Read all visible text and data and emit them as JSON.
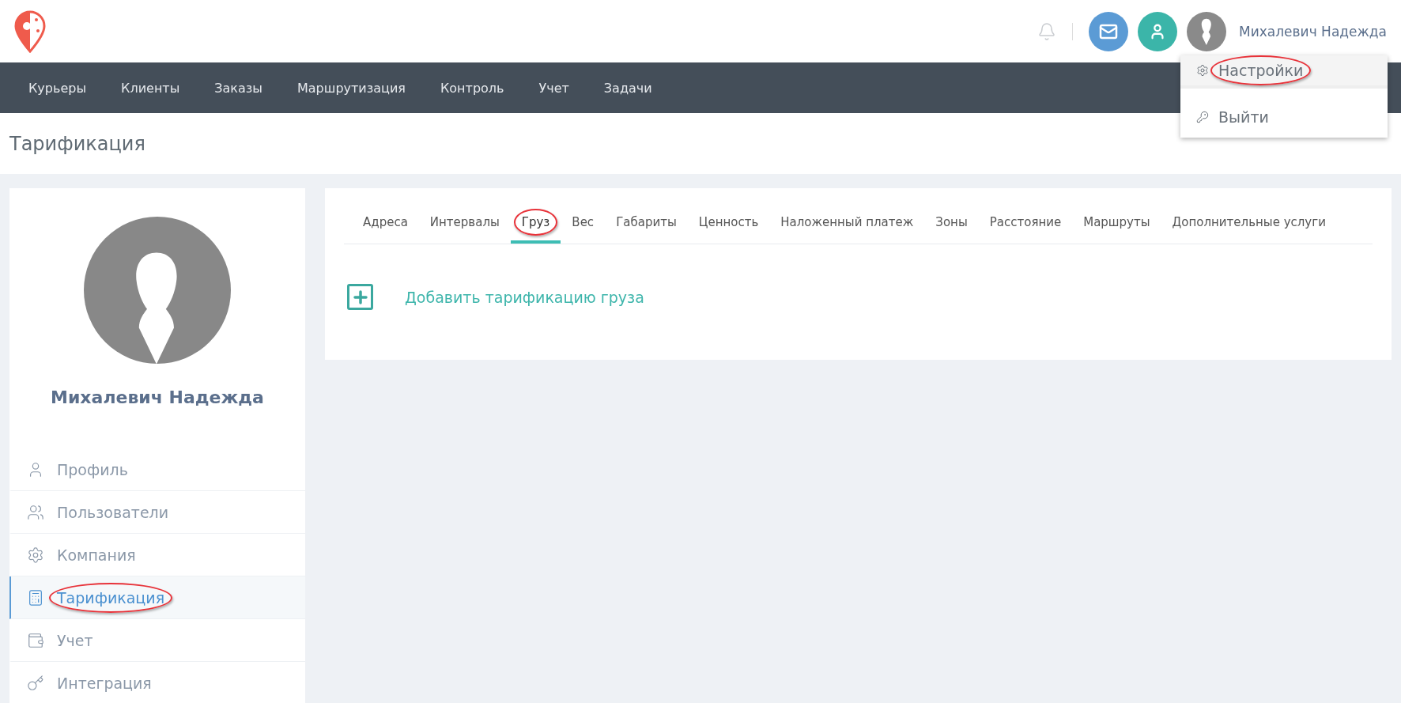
{
  "header": {
    "user_name": "Михалевич Надежда",
    "menu": [
      {
        "label": "Настройки",
        "kind": "settings",
        "selected": true,
        "circled": true
      },
      {
        "label": "Выйти",
        "kind": "logout",
        "selected": false,
        "circled": false
      }
    ]
  },
  "nav": [
    "Курьеры",
    "Клиенты",
    "Заказы",
    "Маршрутизация",
    "Контроль",
    "Учет",
    "Задачи"
  ],
  "page_title": "Тарификация",
  "sidebar": {
    "user_name": "Михалевич Надежда",
    "items": [
      {
        "label": "Профиль",
        "kind": "profile",
        "selected": false,
        "circled": false
      },
      {
        "label": "Пользователи",
        "kind": "users",
        "selected": false,
        "circled": false
      },
      {
        "label": "Компания",
        "kind": "company",
        "selected": false,
        "circled": false
      },
      {
        "label": "Тарификация",
        "kind": "pricing",
        "selected": true,
        "circled": true
      },
      {
        "label": "Учет",
        "kind": "accounting",
        "selected": false,
        "circled": false
      },
      {
        "label": "Интеграция",
        "kind": "integration",
        "selected": false,
        "circled": false
      }
    ]
  },
  "tabs": [
    {
      "label": "Адреса",
      "selected": false,
      "circled": false
    },
    {
      "label": "Интервалы",
      "selected": false,
      "circled": false
    },
    {
      "label": "Груз",
      "selected": true,
      "circled": true
    },
    {
      "label": "Вес",
      "selected": false,
      "circled": false
    },
    {
      "label": "Габариты",
      "selected": false,
      "circled": false
    },
    {
      "label": "Ценность",
      "selected": false,
      "circled": false
    },
    {
      "label": "Наложенный платеж",
      "selected": false,
      "circled": false
    },
    {
      "label": "Зоны",
      "selected": false,
      "circled": false
    },
    {
      "label": "Расстояние",
      "selected": false,
      "circled": false
    },
    {
      "label": "Маршруты",
      "selected": false,
      "circled": false
    },
    {
      "label": "Дополнительные услуги",
      "selected": false,
      "circled": false
    }
  ],
  "add_link": "Добавить тарификацию груза"
}
